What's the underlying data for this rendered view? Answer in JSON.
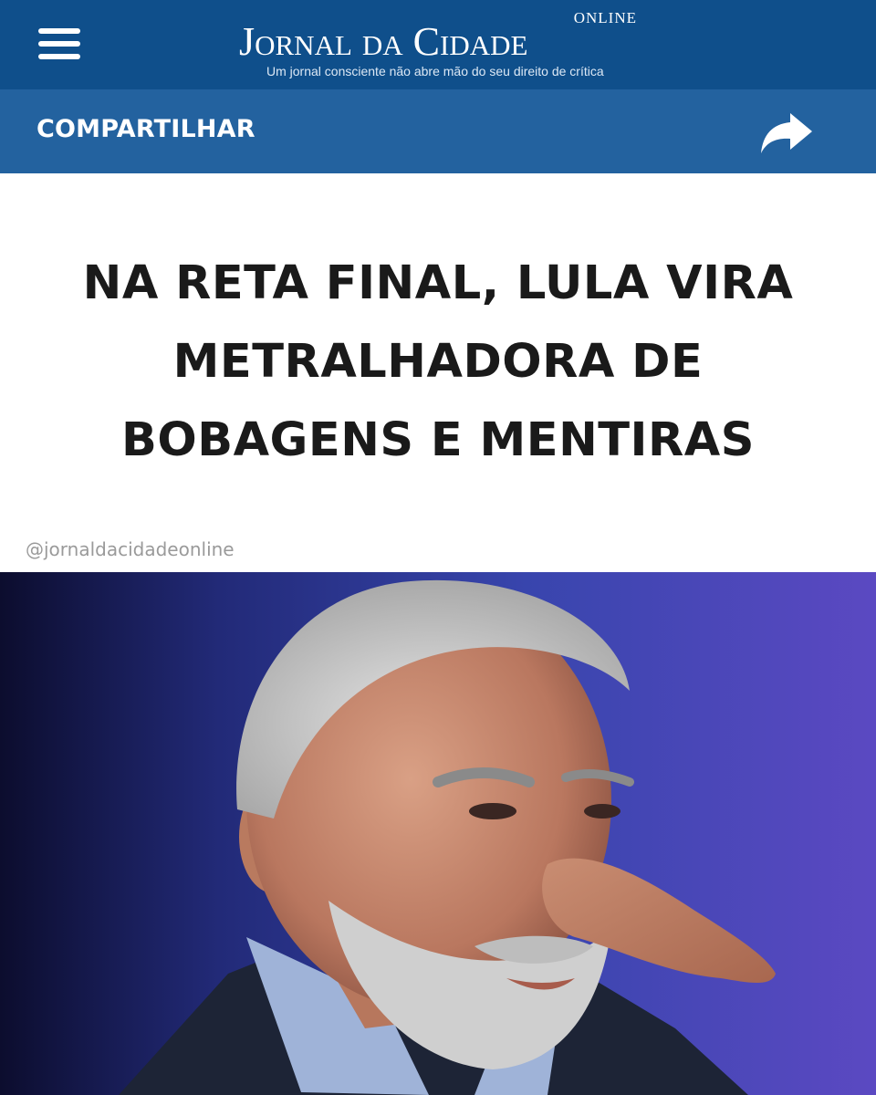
{
  "header": {
    "menu_icon": "hamburger-menu-icon",
    "logo": {
      "online": "ONLINE",
      "name": "Jornal da Cidade",
      "tagline": "Um jornal consciente não abre mão do seu direito de crítica"
    },
    "background": "#0f4f8b"
  },
  "share_bar": {
    "label": "COMPARTILHAR",
    "icon": "share-arrow-icon",
    "background": "#23629f"
  },
  "article": {
    "headline_lines": [
      "NA RETA FINAL, LULA VIRA",
      "METRALHADORA DE",
      "BOBAGENS E MENTIRAS"
    ],
    "handle": "@jornaldacidadeonline"
  }
}
